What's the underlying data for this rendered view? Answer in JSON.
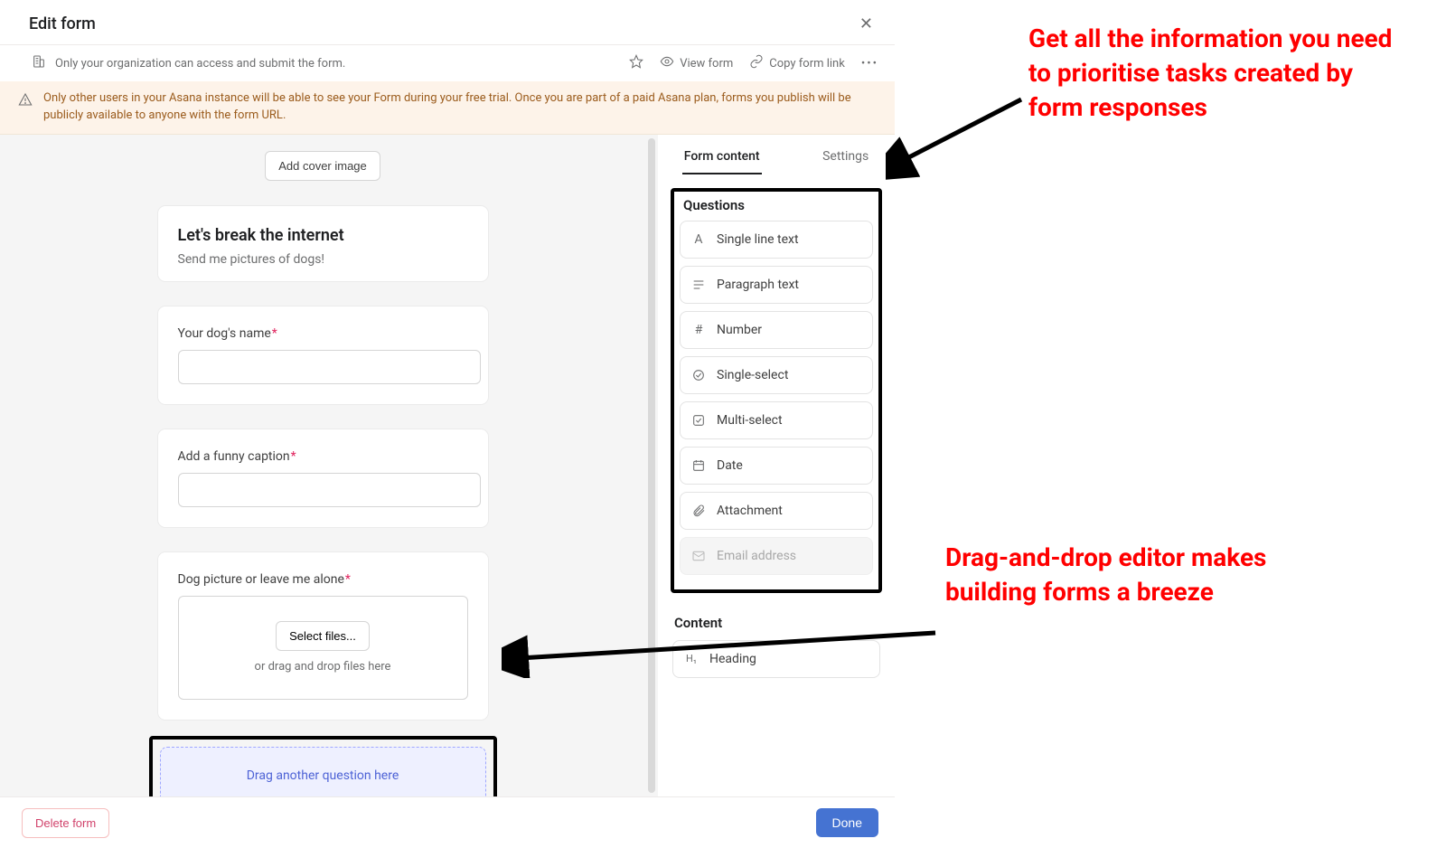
{
  "header": {
    "title": "Edit form",
    "access_text": "Only your organization can access and submit the form.",
    "view_form": "View form",
    "copy_link": "Copy form link"
  },
  "trial_banner": "Only other users in your Asana instance will be able to see your Form during your free trial. Once you are part of a paid Asana plan, forms you publish will be publicly available to anyone with the form URL.",
  "canvas": {
    "cover_btn": "Add cover image",
    "form_title": "Let's break the internet",
    "form_subtitle": "Send me pictures of dogs!",
    "q1_label": "Your dog's name",
    "q2_label": "Add a funny caption",
    "q3_label": "Dog picture or leave me alone",
    "select_files": "Select files...",
    "drag_files_hint": "or drag and drop files here",
    "drop_question": "Drag another question here"
  },
  "palette": {
    "tab_content": "Form content",
    "tab_settings": "Settings",
    "section_questions": "Questions",
    "items": [
      {
        "label": "Single line text"
      },
      {
        "label": "Paragraph text"
      },
      {
        "label": "Number"
      },
      {
        "label": "Single-select"
      },
      {
        "label": "Multi-select"
      },
      {
        "label": "Date"
      },
      {
        "label": "Attachment"
      },
      {
        "label": "Email address"
      }
    ],
    "section_content": "Content",
    "content_items": [
      {
        "label": "Heading"
      }
    ]
  },
  "footer": {
    "delete": "Delete form",
    "done": "Done"
  },
  "annotations": {
    "top": "Get all the information you need to prioritise tasks created by form responses",
    "bottom": "Drag-and-drop editor makes building forms a breeze"
  }
}
